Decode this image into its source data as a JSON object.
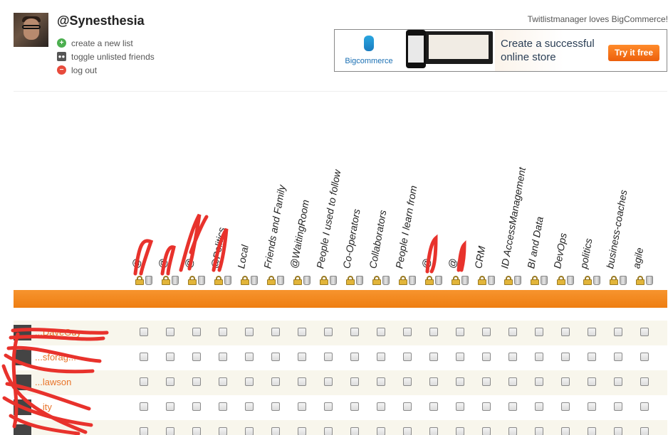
{
  "header": {
    "username": "@Synesthesia",
    "promo_text": "Twitlistmanager loves BigCommerce!"
  },
  "menu": [
    {
      "label": "create a new list",
      "icon": "plus-circle-icon"
    },
    {
      "label": "toggle unlisted friends",
      "icon": "people-icon"
    },
    {
      "label": "log out",
      "icon": "minus-circle-icon"
    }
  ],
  "ad": {
    "brand": "Bigcommerce",
    "headline_line1": "Create a successful",
    "headline_line2": "online store",
    "cta": "Try it free",
    "accent": "#f07019"
  },
  "lists": [
    {
      "label": "@"
    },
    {
      "label": "@"
    },
    {
      "label": "@"
    },
    {
      "label": "@Politics"
    },
    {
      "label": "Local"
    },
    {
      "label": "Friends and Family"
    },
    {
      "label": "@WaitingRoom"
    },
    {
      "label": "People I used to follow"
    },
    {
      "label": "Co-Operators"
    },
    {
      "label": "Collaborators"
    },
    {
      "label": "People I learn from"
    },
    {
      "label": "@"
    },
    {
      "label": "@"
    },
    {
      "label": "CRM"
    },
    {
      "label": "ID AccessManagement"
    },
    {
      "label": "BI and Data"
    },
    {
      "label": "DevOps"
    },
    {
      "label": "politics"
    },
    {
      "label": "business-coaches"
    },
    {
      "label": "agile"
    }
  ],
  "friends": [
    {
      "name": "...DaveGuy"
    },
    {
      "name": "...sforag..."
    },
    {
      "name": "...lawson"
    },
    {
      "name": "...ity"
    },
    {
      "name": ""
    }
  ],
  "colors": {
    "orange_bar": "#f28a22",
    "link": "#e8742a",
    "odd_row": "#f8f6ec"
  }
}
